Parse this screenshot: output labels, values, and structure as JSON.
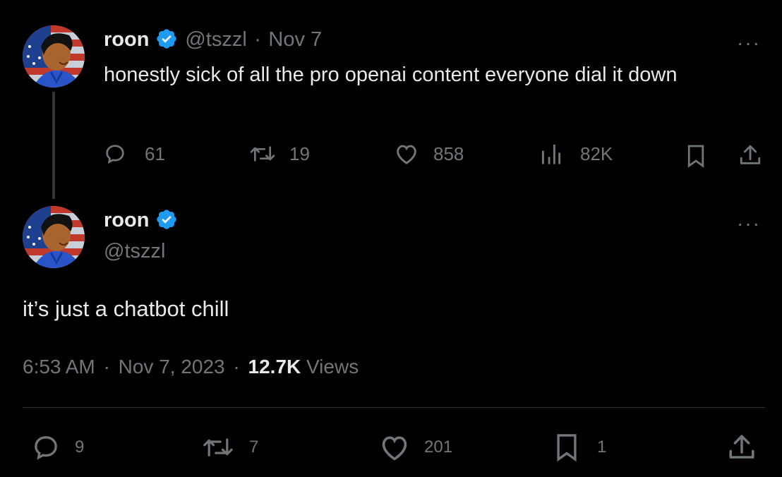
{
  "parent_tweet": {
    "author_name": "roon",
    "handle": "@tszzl",
    "separator": "·",
    "date": "Nov 7",
    "text": "honestly sick of all the pro openai content everyone dial it down",
    "more_label": "···",
    "actions": {
      "replies": "61",
      "retweets": "19",
      "likes": "858",
      "views": "82K"
    }
  },
  "main_tweet": {
    "author_name": "roon",
    "handle": "@tszzl",
    "text": "it’s just a chatbot chill",
    "more_label": "···",
    "time": "6:53 AM",
    "separator": "·",
    "date": "Nov 7, 2023",
    "views_count": "12.7K",
    "views_label": "Views",
    "actions": {
      "replies": "9",
      "retweets": "7",
      "likes": "201",
      "bookmarks": "1"
    }
  },
  "icons": {
    "verified": "verified-badge-icon",
    "reply": "reply-icon",
    "retweet": "retweet-icon",
    "like": "heart-icon",
    "views": "views-chart-icon",
    "bookmark": "bookmark-icon",
    "share": "share-icon"
  },
  "colors": {
    "background": "#000000",
    "text": "#e7e9ea",
    "muted": "#71767b",
    "verified": "#1d9bf0",
    "divider": "#2f3336"
  }
}
